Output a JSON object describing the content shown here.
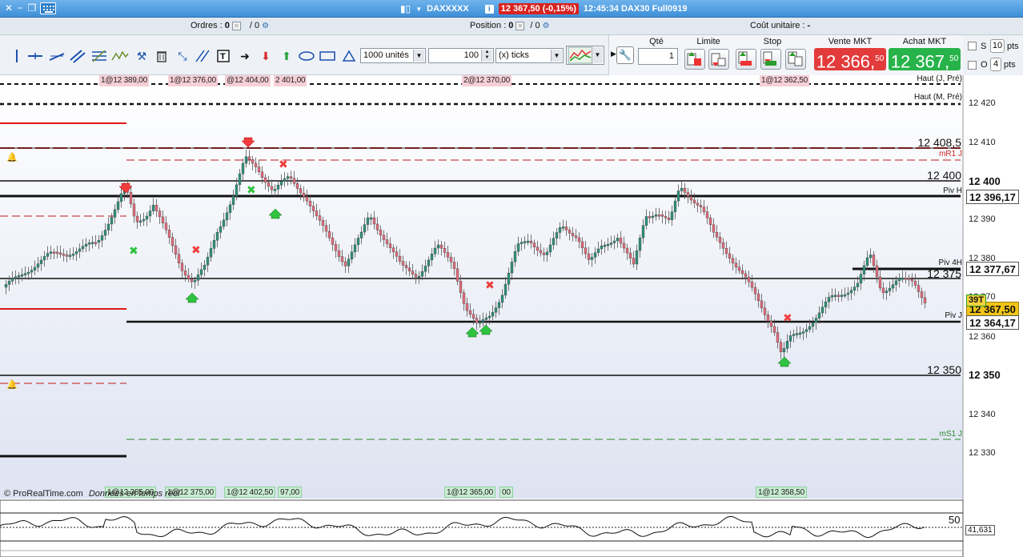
{
  "titlebar": {
    "instrument": "DAXXXXX",
    "price_badge": "12 367,50 (-0,15%)",
    "time_info": "12:45:34 DAX30 Full0919"
  },
  "infobar": {
    "orders_label": "Ordres : ",
    "orders_value": "0",
    "orders_sep": "/ 0",
    "position_label": "Position : ",
    "position_value": "0",
    "position_sep": "/ 0",
    "unit_cost_label": "Coût unitaire : ",
    "unit_cost_value": "-"
  },
  "toolbar": {
    "units_select": "1000 unités",
    "quantity_input": "100",
    "ticks_select": "(x) ticks"
  },
  "order_panel": {
    "qty_label": "Qté",
    "qty_value": "1",
    "limit_label": "Limite",
    "stop_label": "Stop",
    "sell_label": "Vente MKT",
    "sell_price_main": "12 366,",
    "sell_price_dec": "50",
    "buy_label": "Achat MKT",
    "buy_price_main": "12 367,",
    "buy_price_dec": "50",
    "sell_color": "#e33b3b",
    "buy_color": "#27b34a"
  },
  "side_panel": {
    "s_label": "S",
    "s_value": "10",
    "o_label": "O",
    "o_value": "4",
    "unit": "pts"
  },
  "chart": {
    "y_axis_labels": [
      "12 420",
      "12 410",
      "12 390",
      "12 380",
      "12 370",
      "12 360",
      "12 340",
      "12 330"
    ],
    "sell_order_tags": [
      "1@12 389,00",
      "1@12 376,00",
      "@12 404,00",
      "2 401,00",
      "2@12 370,00",
      "1@12 362,50"
    ],
    "buy_order_tags": [
      "1@12 385,00",
      "1@12 375,00",
      "1@12 402,50",
      "97,00",
      "1@12 365,00",
      "00",
      "1@12 358,50"
    ],
    "levels": {
      "haut_j_pre": "Haut (J, Pré)",
      "haut_m_pre": "Haut (M, Pré)",
      "level_12408": "12 408,5",
      "mr1_j": "mR1 J",
      "level_12400": "12 400",
      "piv_h": "Piv H",
      "piv_4h": "Piv 4H",
      "level_12375": "12 375",
      "piv_j": "Piv J",
      "level_12350": "12 350",
      "ms1_j": "mS1 J"
    },
    "level_boxes": {
      "box_12400": "12 400",
      "box_12396": "12 396,17",
      "box_12377": "12 377,67",
      "box_12367": "12 367,50",
      "box_12364": "12 364,17",
      "box_12350": "12 350"
    },
    "countdown": "39T",
    "watermark_brand": "© ProRealTime.com",
    "watermark_note": "Données en temps réel",
    "oscillator_level": "50",
    "oscillator_value": "41,631"
  }
}
